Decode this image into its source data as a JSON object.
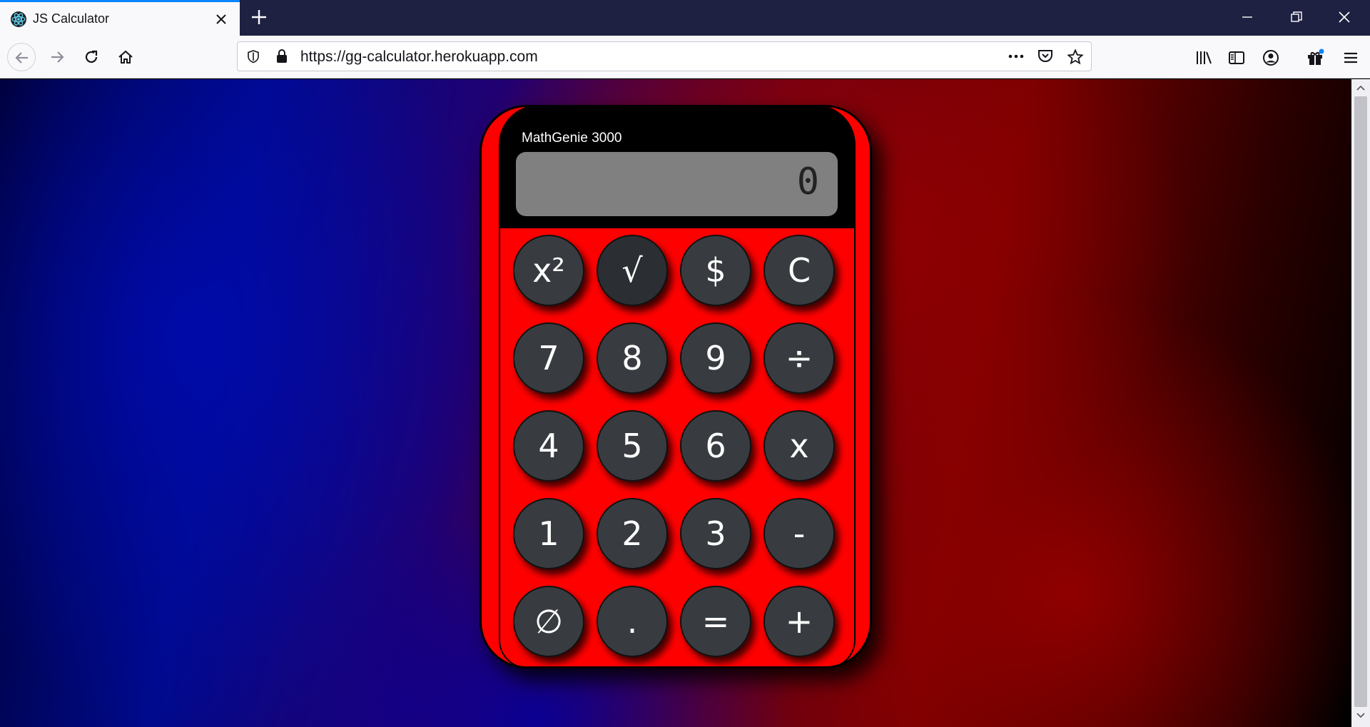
{
  "tab": {
    "title": "JS Calculator",
    "favicon": "react-icon"
  },
  "urlbar": {
    "url": "https://gg-calculator.herokuapp.com"
  },
  "calculator": {
    "brand": "MathGenie 3000",
    "display": "0",
    "keys": [
      [
        "x²",
        "√",
        "$",
        "C"
      ],
      [
        "7",
        "8",
        "9",
        "÷"
      ],
      [
        "4",
        "5",
        "6",
        "x"
      ],
      [
        "1",
        "2",
        "3",
        "-"
      ],
      [
        "∅",
        ".",
        "=",
        "+"
      ]
    ]
  },
  "colors": {
    "calculator_body": "#ff0000",
    "key": "#383c40",
    "display": "#808080",
    "tab_accent": "#0a84ff"
  }
}
